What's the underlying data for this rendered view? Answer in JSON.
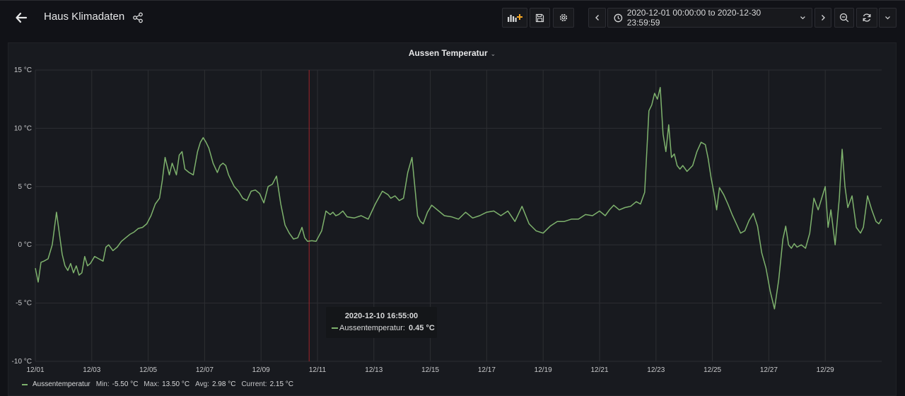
{
  "header": {
    "title": "Haus Klimadaten",
    "time_range": "2020-12-01 00:00:00 to 2020-12-30 23:59:59"
  },
  "icons": {
    "back": "arrow-left-icon",
    "share": "share-icon",
    "add_panel": "add-panel-icon",
    "save": "save-icon",
    "settings": "gear-icon",
    "time_back": "chevron-left-icon",
    "clock": "clock-icon",
    "time_dropdown": "chevron-down-icon",
    "time_forward": "chevron-right-icon",
    "zoom_out": "zoom-out-icon",
    "refresh": "refresh-icon",
    "refresh_dropdown": "chevron-down-icon"
  },
  "colors": {
    "series": "#7eb26d",
    "background": "#111217",
    "panel": "#181a1f",
    "accent": "#f5a623",
    "crosshair": "#a0242a"
  },
  "panel": {
    "title": "Aussen Temperatur",
    "tooltip": {
      "time": "2020-12-10 16:55:00",
      "series": "Aussentemperatur:",
      "value": "0.45 °C"
    },
    "legend": {
      "name": "Aussentemperatur",
      "min_label": "Min:",
      "min": "-5.50 °C",
      "max_label": "Max:",
      "max": "13.50 °C",
      "avg_label": "Avg:",
      "avg": "2.98 °C",
      "current_label": "Current:",
      "current": "2.15 °C"
    }
  },
  "chart_data": {
    "type": "line",
    "title": "Aussen Temperatur",
    "xlabel": "",
    "ylabel": "",
    "x_ticks": [
      "12/01",
      "12/03",
      "12/05",
      "12/07",
      "12/09",
      "12/11",
      "12/13",
      "12/15",
      "12/17",
      "12/19",
      "12/21",
      "12/23",
      "12/25",
      "12/27",
      "12/29"
    ],
    "y_ticks": [
      "15 °C",
      "10 °C",
      "5 °C",
      "0 °C",
      "-5 °C",
      "-10 °C"
    ],
    "ylim": [
      -10,
      15
    ],
    "xlim": [
      0,
      30
    ],
    "grid": true,
    "legend_position": "bottom-left",
    "series": [
      {
        "name": "Aussentemperatur",
        "x": [
          0.0,
          0.1,
          0.2,
          0.3,
          0.45,
          0.6,
          0.75,
          0.85,
          0.95,
          1.05,
          1.15,
          1.25,
          1.35,
          1.45,
          1.55,
          1.65,
          1.75,
          1.85,
          1.95,
          2.1,
          2.25,
          2.4,
          2.5,
          2.6,
          2.75,
          2.9,
          3.05,
          3.2,
          3.35,
          3.5,
          3.65,
          3.8,
          3.95,
          4.1,
          4.25,
          4.4,
          4.5,
          4.6,
          4.75,
          4.85,
          5.0,
          5.1,
          5.2,
          5.3,
          5.45,
          5.6,
          5.75,
          5.85,
          5.95,
          6.05,
          6.15,
          6.3,
          6.45,
          6.55,
          6.65,
          6.75,
          6.85,
          6.95,
          7.05,
          7.2,
          7.35,
          7.5,
          7.65,
          7.8,
          7.95,
          8.1,
          8.25,
          8.4,
          8.55,
          8.7,
          8.85,
          9.0,
          9.15,
          9.3,
          9.45,
          9.55,
          9.65,
          9.8,
          9.95,
          10.15,
          10.3,
          10.45,
          10.55,
          10.65,
          10.75,
          10.9,
          11.05,
          11.3,
          11.55,
          11.8,
          12.05,
          12.3,
          12.5,
          12.6,
          12.75,
          12.9,
          13.05,
          13.2,
          13.35,
          13.45,
          13.55,
          13.65,
          13.75,
          13.9,
          14.05,
          14.25,
          14.5,
          14.75,
          15.0,
          15.25,
          15.5,
          15.75,
          16.0,
          16.25,
          16.5,
          16.75,
          17.0,
          17.25,
          17.5,
          17.75,
          18.0,
          18.25,
          18.5,
          18.75,
          19.0,
          19.25,
          19.5,
          19.75,
          20.0,
          20.2,
          20.35,
          20.5,
          20.7,
          20.9,
          21.1,
          21.3,
          21.45,
          21.6,
          21.75,
          21.85,
          21.95,
          22.05,
          22.15,
          22.25,
          22.35,
          22.45,
          22.55,
          22.65,
          22.75,
          22.85,
          22.95,
          23.1,
          23.3,
          23.45,
          23.6,
          23.75,
          23.85,
          23.95,
          24.05,
          24.15,
          24.25,
          24.4,
          24.55,
          24.7,
          24.85,
          25.0,
          25.15,
          25.3,
          25.45,
          25.6,
          25.75,
          25.9,
          26.05,
          26.2,
          26.35,
          26.5,
          26.6,
          26.7,
          26.8,
          26.9,
          27.0,
          27.15,
          27.3,
          27.45,
          27.6,
          27.75,
          27.9,
          28.0,
          28.1,
          28.2,
          28.35,
          28.5,
          28.6,
          28.7,
          28.8,
          28.95,
          29.1,
          29.25,
          29.35,
          29.5,
          29.65,
          29.8,
          29.9,
          30.0
        ],
        "y": [
          -2.0,
          -3.2,
          -1.5,
          -1.4,
          -1.2,
          0.0,
          2.8,
          1.0,
          -0.8,
          -1.8,
          -2.2,
          -1.6,
          -2.4,
          -1.8,
          -2.6,
          -2.4,
          -1.0,
          -1.8,
          -1.6,
          -1.0,
          -1.2,
          -1.4,
          -0.2,
          0.0,
          -0.5,
          -0.2,
          0.3,
          0.6,
          0.9,
          1.1,
          1.4,
          1.5,
          1.8,
          2.5,
          3.5,
          4.0,
          5.5,
          7.5,
          6.0,
          7.0,
          6.0,
          7.7,
          8.0,
          6.5,
          6.2,
          6.0,
          8.0,
          8.8,
          9.2,
          8.8,
          8.3,
          7.0,
          6.2,
          6.8,
          7.0,
          6.8,
          6.0,
          5.5,
          5.0,
          4.6,
          4.0,
          3.8,
          4.6,
          4.7,
          4.4,
          3.6,
          5.0,
          5.2,
          5.9,
          3.5,
          1.7,
          1.0,
          0.5,
          0.6,
          1.5,
          0.6,
          0.3,
          0.35,
          0.3,
          1.2,
          2.9,
          2.6,
          2.8,
          2.5,
          2.6,
          2.9,
          2.4,
          2.3,
          2.5,
          2.2,
          3.5,
          4.6,
          4.3,
          4.0,
          4.2,
          3.8,
          4.0,
          6.2,
          7.5,
          5.0,
          2.5,
          2.0,
          1.8,
          2.8,
          3.4,
          3.0,
          2.5,
          2.4,
          2.2,
          2.8,
          2.3,
          2.5,
          2.8,
          2.9,
          2.5,
          2.9,
          2.0,
          3.3,
          1.8,
          1.2,
          1.0,
          1.6,
          2.0,
          2.0,
          2.2,
          2.2,
          2.6,
          2.5,
          2.9,
          2.5,
          3.0,
          3.4,
          3.0,
          3.2,
          3.3,
          3.7,
          3.5,
          4.5,
          11.5,
          12.0,
          13.0,
          12.5,
          13.5,
          9.5,
          8.0,
          10.3,
          7.5,
          7.8,
          6.8,
          6.5,
          6.8,
          6.3,
          6.8,
          8.0,
          8.8,
          8.6,
          7.4,
          5.8,
          4.5,
          3.0,
          4.9,
          4.3,
          3.5,
          2.6,
          1.8,
          1.0,
          1.2,
          2.1,
          2.7,
          1.6,
          -0.7,
          -2.0,
          -4.0,
          -5.5,
          -3.0,
          0.5,
          1.6,
          0.0,
          -0.3,
          0.1,
          -0.2,
          0.0,
          -0.3,
          1.0,
          4.0,
          3.0,
          4.2,
          5.0,
          1.5,
          3.0,
          0.0,
          4.0,
          8.2,
          5.0,
          3.2,
          4.2,
          1.5,
          1.0,
          1.5,
          4.2,
          3.0,
          2.0,
          1.8,
          2.2
        ]
      }
    ]
  }
}
